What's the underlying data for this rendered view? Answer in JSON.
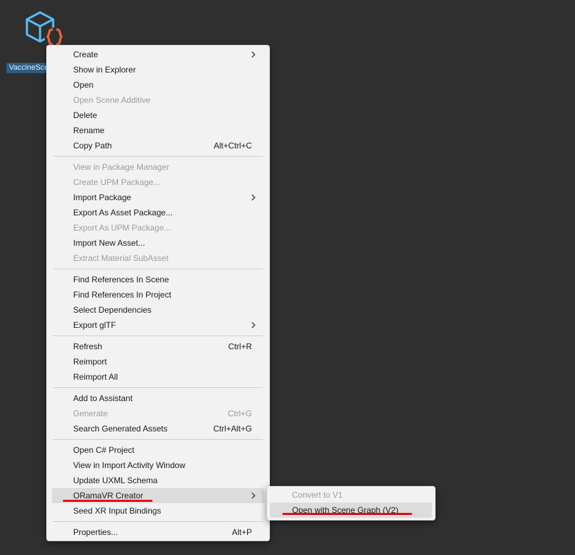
{
  "asset": {
    "name": "VaccineSce",
    "icon": "scene-script-asset-icon"
  },
  "context_menu": {
    "items": [
      {
        "label": "Create",
        "submenu": true
      },
      {
        "label": "Show in Explorer"
      },
      {
        "label": "Open"
      },
      {
        "label": "Open Scene Additive",
        "disabled": true
      },
      {
        "label": "Delete"
      },
      {
        "label": "Rename"
      },
      {
        "label": "Copy Path",
        "shortcut": "Alt+Ctrl+C"
      },
      {
        "label": "View in Package Manager",
        "disabled": true
      },
      {
        "label": "Create UPM Package...",
        "disabled": true
      },
      {
        "label": "Import Package",
        "submenu": true
      },
      {
        "label": "Export As Asset Package..."
      },
      {
        "label": "Export As UPM Package...",
        "disabled": true
      },
      {
        "label": "Import New Asset..."
      },
      {
        "label": "Extract Material SubAsset",
        "disabled": true
      },
      {
        "label": "Find References In Scene"
      },
      {
        "label": "Find References In Project"
      },
      {
        "label": "Select Dependencies"
      },
      {
        "label": "Export glTF",
        "submenu": true
      },
      {
        "label": "Refresh",
        "shortcut": "Ctrl+R"
      },
      {
        "label": "Reimport"
      },
      {
        "label": "Reimport All"
      },
      {
        "label": "Add to Assistant"
      },
      {
        "label": "Generate",
        "shortcut": "Ctrl+G",
        "disabled": true
      },
      {
        "label": "Search Generated Assets",
        "shortcut": "Ctrl+Alt+G"
      },
      {
        "label": "Open C# Project"
      },
      {
        "label": "View in Import Activity Window"
      },
      {
        "label": "Update UXML Schema"
      },
      {
        "label": "ORamaVR Creator",
        "submenu": true,
        "highlighted": true
      },
      {
        "label": "Seed XR Input Bindings"
      },
      {
        "label": "Properties...",
        "shortcut": "Alt+P"
      }
    ]
  },
  "submenu": {
    "items": [
      {
        "label": "Convert to V1",
        "disabled": true
      },
      {
        "label": "Open with Scene Graph (V2)",
        "highlighted": true
      }
    ]
  },
  "colors": {
    "background": "#2f2f2f",
    "menu_bg": "#f2f2f2",
    "highlight": "#dcdcdc",
    "disabled_text": "#9c9c9c",
    "annotation_underline": "#e30613",
    "asset_icon_blue": "#5cb8f0",
    "asset_icon_orange": "#e8643c"
  }
}
